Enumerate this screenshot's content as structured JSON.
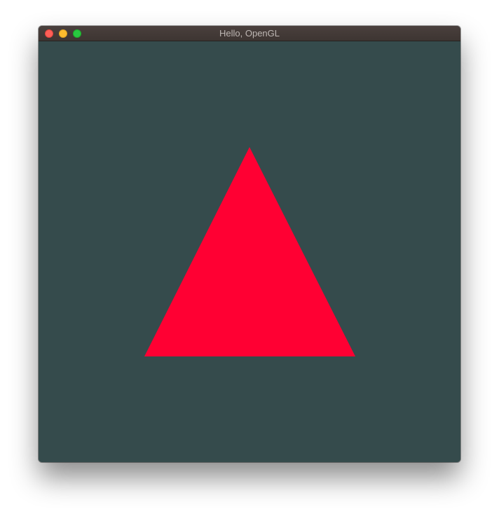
{
  "window": {
    "title": "Hello, OpenGL"
  },
  "controls": {
    "close": "close-button",
    "minimize": "minimize-button",
    "zoom": "zoom-button"
  },
  "scene": {
    "clear_color": "#354b4c",
    "shape": "triangle",
    "shape_color": "#ff0033"
  }
}
